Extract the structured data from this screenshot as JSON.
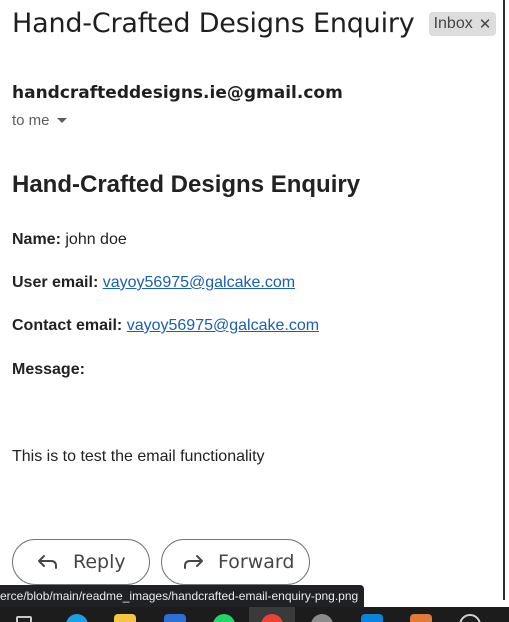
{
  "email": {
    "subject": "Hand-Crafted Designs Enquiry",
    "label": "Inbox",
    "label_remove_icon": "close-icon",
    "sender": "handcrafteddesigns.ie@gmail.com",
    "recipient": "to me"
  },
  "body": {
    "title": "Hand-Crafted Designs Enquiry",
    "name_label": "Name:",
    "name_value": "john doe",
    "user_email_label": "User email:",
    "user_email_value": "vayoy56975@galcake.com",
    "contact_email_label": "Contact email:",
    "contact_email_value": "vayoy56975@galcake.com",
    "message_label": "Message:",
    "message_value": "This is to test the email functionality"
  },
  "actions": {
    "reply_label": "Reply",
    "reply_icon": "reply-icon",
    "forward_label": "Forward",
    "forward_icon": "forward-icon"
  },
  "status_bar": {
    "url": "erce/blob/main/readme_images/handcrafted-email-enquiry-png.png"
  },
  "taskbar": {
    "icons": [
      "start-icon",
      "edge-icon",
      "file-explorer-icon",
      "store-icon",
      "whatsapp-icon",
      "chrome-icon",
      "settings-icon",
      "vscode-icon",
      "app-icon",
      "misc-icon"
    ]
  },
  "colors": {
    "link": "#1a5fb4",
    "chip_bg": "#dddddd",
    "taskbar_bg": "#1c1c1c",
    "status_bg": "#202124"
  }
}
